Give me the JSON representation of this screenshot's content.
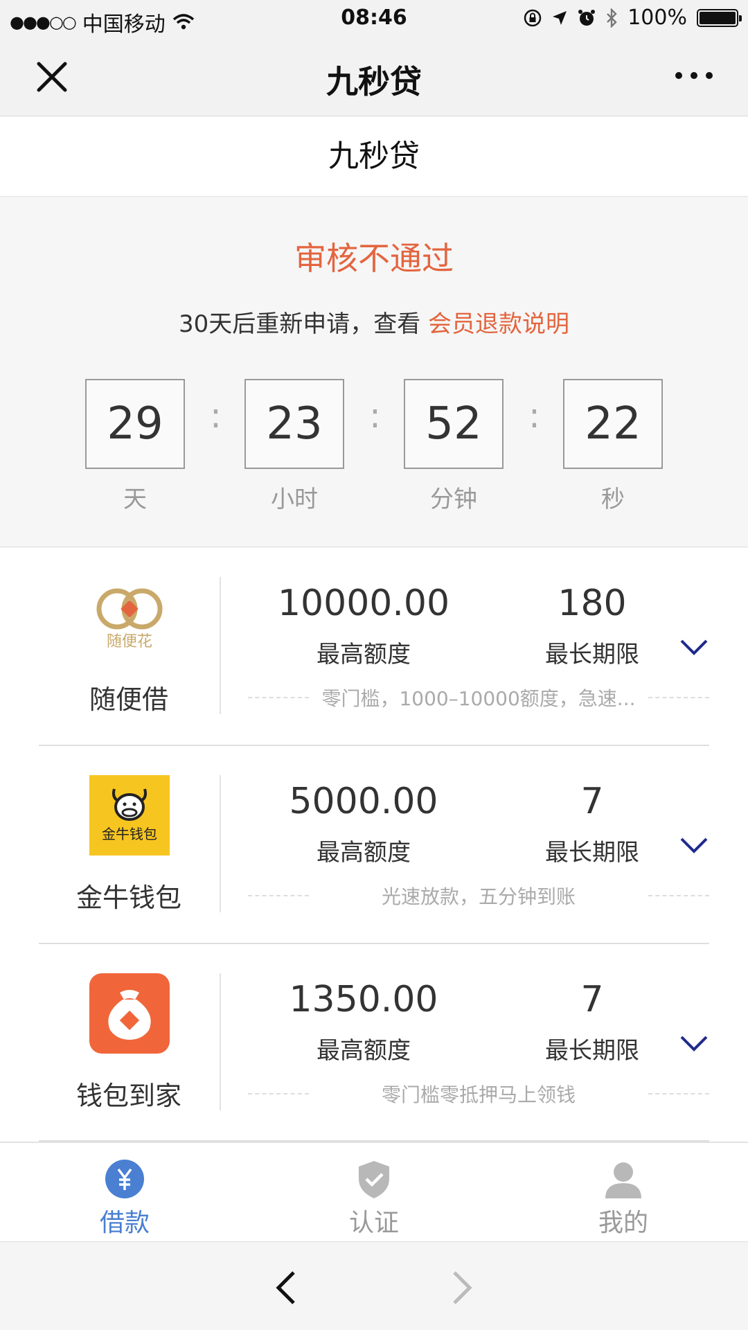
{
  "status_bar": {
    "signal": "●●●○○",
    "carrier": "中国移动",
    "time": "08:46",
    "battery": "100%"
  },
  "nav": {
    "title": "九秒贷",
    "close_icon": "close-icon",
    "more_icon": "more-icon"
  },
  "page": {
    "header": "九秒贷"
  },
  "review": {
    "title": "审核不通过",
    "subtitle": "30天后重新申请，查看",
    "link": "会员退款说明"
  },
  "countdown": {
    "separator": ":",
    "units": [
      {
        "value": "29",
        "label": "天"
      },
      {
        "value": "23",
        "label": "小时"
      },
      {
        "value": "52",
        "label": "分钟"
      },
      {
        "value": "22",
        "label": "秒"
      }
    ]
  },
  "loans": [
    {
      "name": "随便借",
      "logo_text": "随便花",
      "logo_icon": "rings-logo",
      "amount": "10000.00",
      "amount_label": "最高额度",
      "term": "180",
      "term_label": "最长期限",
      "desc": "零门槛，1000–10000额度，急速..."
    },
    {
      "name": "金牛钱包",
      "logo_text": "金牛钱包",
      "logo_icon": "bull-logo",
      "amount": "5000.00",
      "amount_label": "最高额度",
      "term": "7",
      "term_label": "最长期限",
      "desc": "光速放款，五分钟到账"
    },
    {
      "name": "钱包到家",
      "logo_icon": "moneybag-logo",
      "amount": "1350.00",
      "amount_label": "最高额度",
      "term": "7",
      "term_label": "最长期限",
      "desc": "零门槛零抵押马上领钱"
    }
  ],
  "tabs": [
    {
      "label": "借款",
      "icon": "yuan-icon",
      "active": true
    },
    {
      "label": "认证",
      "icon": "shield-icon",
      "active": false
    },
    {
      "label": "我的",
      "icon": "person-icon",
      "active": false
    }
  ],
  "colors": {
    "accent": "#e3653f",
    "tab_active": "#4a7fd2",
    "chevron": "#1f2a8c",
    "gold": "#f7c520",
    "orange": "#f0663a"
  }
}
